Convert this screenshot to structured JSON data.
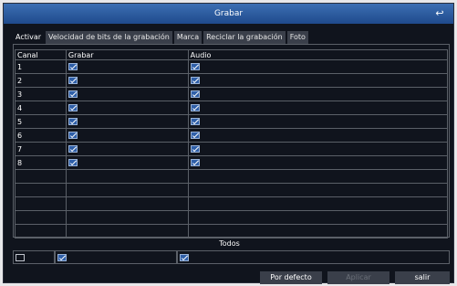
{
  "window": {
    "title": "Grabar",
    "back_icon": "return-icon"
  },
  "tabs": [
    {
      "label": "Activar"
    },
    {
      "label": "Velocidad de bits de la grabación"
    },
    {
      "label": "Marca"
    },
    {
      "label": "Reciclar la grabación"
    },
    {
      "label": "Foto"
    }
  ],
  "table": {
    "headers": [
      "Canal",
      "Grabar",
      "Audio"
    ],
    "rows": [
      {
        "canal": "1",
        "grabar": true,
        "audio": true
      },
      {
        "canal": "2",
        "grabar": true,
        "audio": true
      },
      {
        "canal": "3",
        "grabar": true,
        "audio": true
      },
      {
        "canal": "4",
        "grabar": true,
        "audio": true
      },
      {
        "canal": "5",
        "grabar": true,
        "audio": true
      },
      {
        "canal": "6",
        "grabar": true,
        "audio": true
      },
      {
        "canal": "7",
        "grabar": true,
        "audio": true
      },
      {
        "canal": "8",
        "grabar": true,
        "audio": true
      }
    ],
    "empty_rows": 5
  },
  "todos": {
    "label": "Todos",
    "canal": false,
    "grabar": true,
    "audio": true
  },
  "buttons": {
    "default_label": "Por defecto",
    "apply_label": "Aplicar",
    "exit_label": "salir"
  },
  "colors": {
    "title_bar": "#2b5aa0",
    "background": "#10141d",
    "checkbox": "#2f5fa8"
  }
}
